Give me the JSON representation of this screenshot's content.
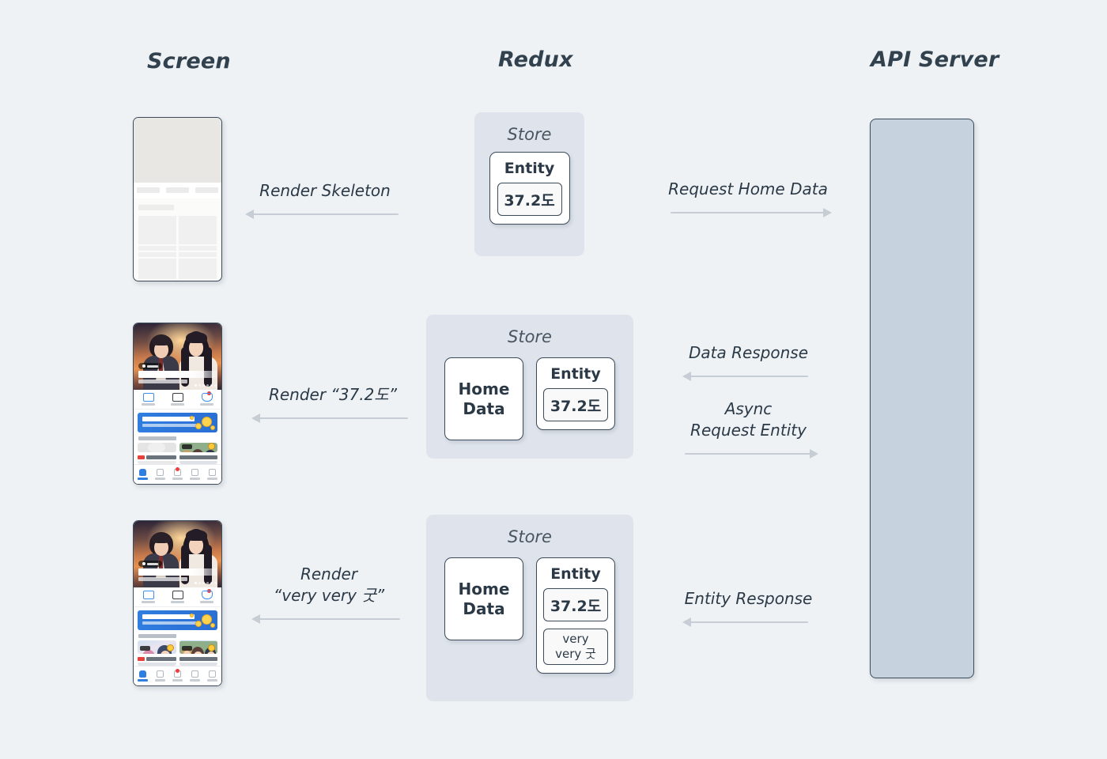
{
  "columns": {
    "screen": "Screen",
    "redux": "Redux",
    "api": "API Server"
  },
  "store_label": "Store",
  "rows": [
    {
      "id": "row-skeleton",
      "left_arrow": {
        "label": "Render Skeleton",
        "direction": "left"
      },
      "right_arrow": {
        "label": "Request Home Data",
        "direction": "right"
      },
      "store": {
        "label": "Store",
        "boxes": [
          {
            "type": "entity",
            "title": "Entity",
            "chips": [
              "37.2도"
            ]
          }
        ]
      },
      "phone": {
        "state": "skeleton"
      }
    },
    {
      "id": "row-home-data",
      "left_arrow": {
        "label": "Render “37.2도”",
        "direction": "left"
      },
      "right_arrows": [
        {
          "label": "Data Response",
          "direction": "left"
        },
        {
          "label_line1": "Async",
          "label_line2": "Request Entity",
          "direction": "right"
        }
      ],
      "store": {
        "label": "Store",
        "boxes": [
          {
            "type": "home",
            "line1": "Home",
            "line2": "Data"
          },
          {
            "type": "entity",
            "title": "Entity",
            "chips": [
              "37.2도"
            ]
          }
        ]
      },
      "phone": {
        "state": "partial"
      }
    },
    {
      "id": "row-entity",
      "left_arrow": {
        "label_line1": "Render",
        "label_line2": "“very very 굿”",
        "direction": "left"
      },
      "right_arrow": {
        "label": "Entity Response",
        "direction": "left"
      },
      "store": {
        "label": "Store",
        "boxes": [
          {
            "type": "home",
            "line1": "Home",
            "line2": "Data"
          },
          {
            "type": "entity",
            "title": "Entity",
            "chips": [
              "37.2도",
              "very\nvery 굿"
            ]
          }
        ]
      },
      "phone": {
        "state": "loaded"
      }
    }
  ],
  "entity_chips": {
    "temperature": "37.2도",
    "very_line1": "very",
    "very_line2": "very 굿"
  },
  "home_box": {
    "line1": "Home",
    "line2": "Data"
  },
  "entity_box": {
    "title": "Entity"
  },
  "labels": {
    "render_skeleton": "Render Skeleton",
    "request_home_data": "Request Home Data",
    "render_372": "Render “37.2도”",
    "data_response": "Data Response",
    "async": "Async",
    "request_entity": "Request Entity",
    "render": "Render",
    "very_very_good_quoted": "“very very 굿”",
    "entity_response": "Entity Response"
  },
  "colors": {
    "background": "#eef2f5",
    "store_panel": "#dfe4ec",
    "box_border": "#3c4b5a",
    "heading_text": "#32414e",
    "arrow": "#c6cdd4",
    "api_server_fill": "#c6d2de",
    "app_accent_blue": "#2f7fe0",
    "skeleton_gray": "#e9e7e4"
  }
}
